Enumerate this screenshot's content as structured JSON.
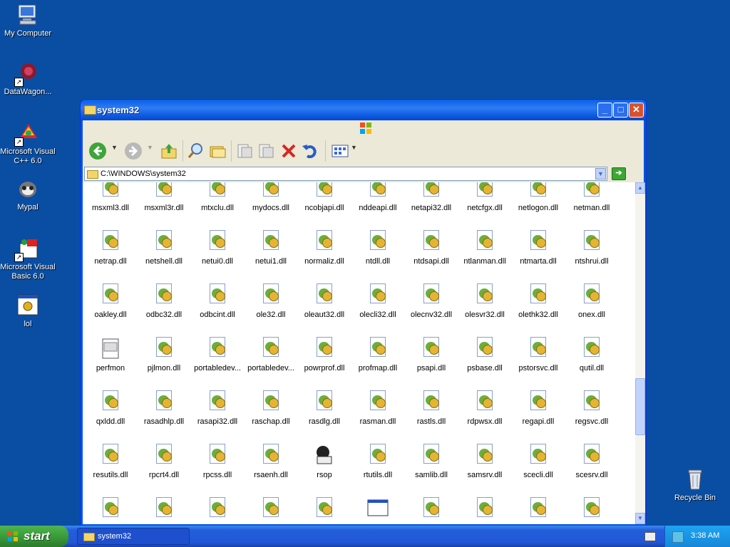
{
  "desktop": {
    "icons": [
      {
        "label": "My Computer"
      },
      {
        "label": "DataWagon..."
      },
      {
        "label": "Microsoft Visual C++ 6.0"
      },
      {
        "label": "Mypal"
      },
      {
        "label": "Microsoft Visual Basic 6.0"
      },
      {
        "label": "lol"
      }
    ],
    "recycle_bin": "Recycle Bin"
  },
  "window": {
    "title": "system32",
    "address": "C:\\WINDOWS\\system32",
    "files": [
      "msxml3.dll",
      "msxml3r.dll",
      "mtxclu.dll",
      "mydocs.dll",
      "ncobjapi.dll",
      "nddeapi.dll",
      "netapi32.dll",
      "netcfgx.dll",
      "netlogon.dll",
      "netman.dll",
      "netrap.dll",
      "netshell.dll",
      "netui0.dll",
      "netui1.dll",
      "normaliz.dll",
      "ntdll.dll",
      "ntdsapi.dll",
      "ntlanman.dll",
      "ntmarta.dll",
      "ntshrui.dll",
      "oakley.dll",
      "odbc32.dll",
      "odbcint.dll",
      "ole32.dll",
      "oleaut32.dll",
      "olecli32.dll",
      "olecnv32.dll",
      "olesvr32.dll",
      "olethk32.dll",
      "onex.dll",
      "perfmon",
      "pjlmon.dll",
      "portabledev...",
      "portabledev...",
      "powrprof.dll",
      "profmap.dll",
      "psapi.dll",
      "psbase.dll",
      "pstorsvc.dll",
      "qutil.dll",
      "qxldd.dll",
      "rasadhlp.dll",
      "rasapi32.dll",
      "raschap.dll",
      "rasdlg.dll",
      "rasman.dll",
      "rastls.dll",
      "rdpwsx.dll",
      "regapi.dll",
      "regsvc.dll",
      "resutils.dll",
      "rpcrt4.dll",
      "rpcss.dll",
      "rsaenh.dll",
      "rsop",
      "rtutils.dll",
      "samlib.dll",
      "samsrv.dll",
      "scecli.dll",
      "scesrv.dll"
    ]
  },
  "taskbar": {
    "start_label": "start",
    "task_label": "system32",
    "clock": "3:38 AM"
  }
}
